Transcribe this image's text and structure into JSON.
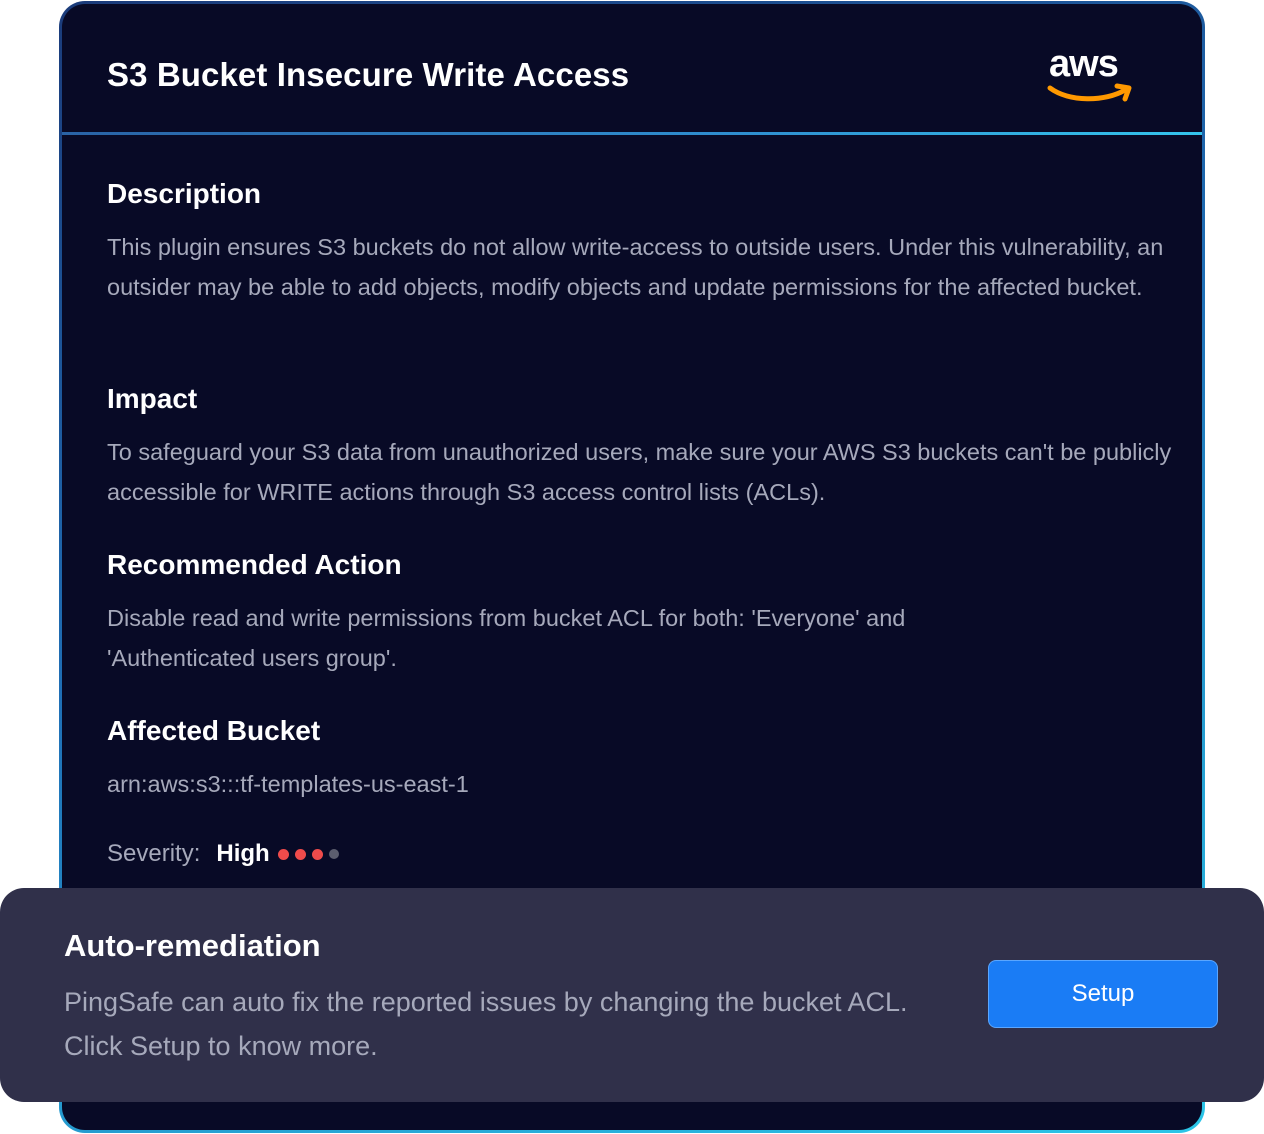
{
  "card": {
    "title": "S3 Bucket Insecure Write Access",
    "logo": {
      "text": "aws",
      "smile_color": "#ff9900"
    }
  },
  "sections": {
    "description": {
      "heading": "Description",
      "body": "This plugin ensures S3 buckets do not allow write-access to outside users. Under this vulnerability, an outsider may be able to add objects, modify objects and update permissions for the affected bucket."
    },
    "impact": {
      "heading": "Impact",
      "body": "To safeguard your S3 data from unauthorized users, make sure your AWS S3 buckets can't be publicly accessible for WRITE actions through S3 access control lists (ACLs)."
    },
    "recommended_action": {
      "heading": "Recommended Action",
      "body": "Disable read and write permissions from bucket ACL for both: 'Everyone' and 'Authenticated users group'."
    },
    "affected_bucket": {
      "heading": "Affected Bucket",
      "body": "arn:aws:s3:::tf-templates-us-east-1"
    }
  },
  "severity": {
    "label": "Severity:",
    "value": "High",
    "level": 3,
    "max_level": 4,
    "active_color": "#ef4b4b",
    "inactive_color": "#5c5e6e"
  },
  "remediation": {
    "title": "Auto-remediation",
    "body": "PingSafe can auto fix the reported issues by changing the bucket ACL. Click Setup to know more.",
    "button_label": "Setup",
    "button_color": "#1a7cf5"
  },
  "colors": {
    "card_background": "#080a26",
    "panel_background": "#30304a",
    "body_text": "#a6a9bb",
    "accent_border": "#2bc6e8"
  }
}
